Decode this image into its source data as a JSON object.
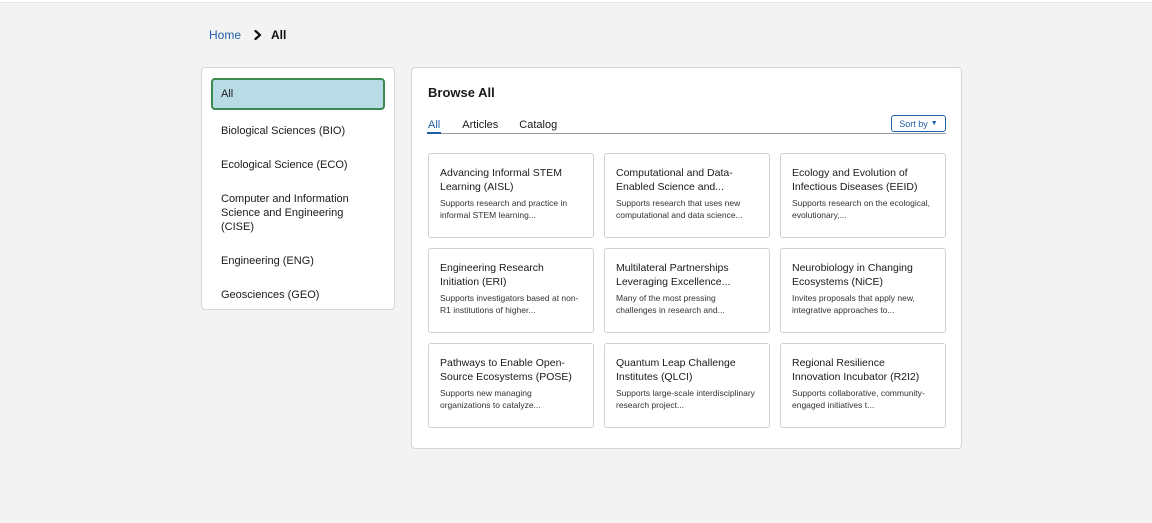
{
  "breadcrumb": {
    "home": "Home",
    "current": "All"
  },
  "sidebar": {
    "items": [
      {
        "label": "All",
        "active": true
      },
      {
        "label": "Biological Sciences (BIO)"
      },
      {
        "label": "Ecological Science (ECO)"
      },
      {
        "label": "Computer and Information Science and Engineering (CISE)"
      },
      {
        "label": "Engineering (ENG)"
      },
      {
        "label": "Geosciences (GEO)"
      }
    ]
  },
  "main": {
    "title": "Browse All",
    "tabs": [
      {
        "label": "All",
        "active": true
      },
      {
        "label": "Articles"
      },
      {
        "label": "Catalog"
      }
    ],
    "sort_label": "Sort by",
    "cards": [
      {
        "title": "Advancing Informal STEM Learning (AISL)",
        "desc": "Supports research and practice in informal STEM learning..."
      },
      {
        "title": "Computational and Data-Enabled Science and...",
        "desc": "Supports research that uses new computational and data science..."
      },
      {
        "title": "Ecology and Evolution of Infectious Diseases (EEID)",
        "desc": "Supports research on the ecological, evolutionary,..."
      },
      {
        "title": "Engineering Research Initiation (ERI)",
        "desc": "Supports investigators based at non-R1 institutions of higher..."
      },
      {
        "title": "Multilateral Partnerships Leveraging Excellence...",
        "desc": "Many of the most pressing challenges in research and..."
      },
      {
        "title": "Neurobiology in Changing Ecosystems (NiCE)",
        "desc": "Invites proposals that apply new, integrative approaches to..."
      },
      {
        "title": "Pathways to Enable Open-Source Ecosystems (POSE)",
        "desc": "Supports new managing organizations to catalyze..."
      },
      {
        "title": "Quantum Leap Challenge Institutes (QLCI)",
        "desc": "Supports large-scale interdisciplinary research project..."
      },
      {
        "title": "Regional Resilience Innovation Incubator (R2I2)",
        "desc": "Supports collaborative, community-engaged initiatives t..."
      }
    ]
  }
}
